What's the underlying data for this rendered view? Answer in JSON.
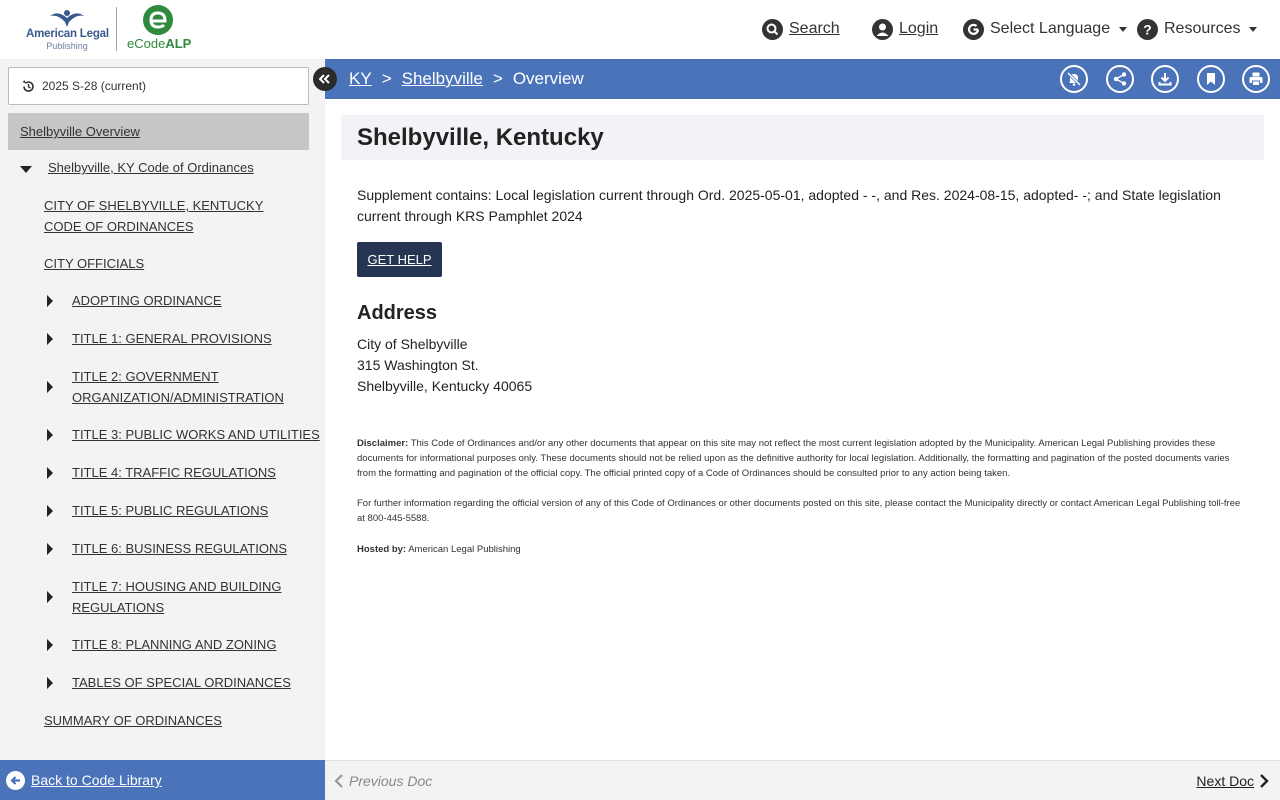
{
  "header": {
    "logo_alp_line1": "American Legal",
    "logo_alp_line2": "Publishing",
    "logo_ecode_prefix": "eCode",
    "logo_ecode_suffix": "ALP",
    "nav": {
      "search": "Search",
      "login": "Login",
      "language": "Select Language",
      "resources": "Resources"
    }
  },
  "sidebar": {
    "version": "2025 S-28 (current)",
    "active_item": "Shelbyville Overview",
    "code_root": "Shelbyville, KY Code of Ordinances",
    "items": [
      "CITY OF SHELBYVILLE, KENTUCKY CODE OF ORDINANCES",
      "CITY OFFICIALS",
      "ADOPTING ORDINANCE",
      "TITLE 1: GENERAL PROVISIONS",
      "TITLE 2: GOVERNMENT ORGANIZATION/ADMINISTRATION",
      "TITLE 3: PUBLIC WORKS AND UTILITIES",
      "TITLE 4: TRAFFIC REGULATIONS",
      "TITLE 5: PUBLIC REGULATIONS",
      "TITLE 6: BUSINESS REGULATIONS",
      "TITLE 7: HOUSING AND BUILDING REGULATIONS",
      "TITLE 8: PLANNING AND ZONING",
      "TABLES OF SPECIAL ORDINANCES",
      "SUMMARY OF ORDINANCES"
    ]
  },
  "breadcrumb": {
    "state": "KY",
    "city": "Shelbyville",
    "current": "Overview",
    "separator": ">"
  },
  "content": {
    "title": "Shelbyville, Kentucky",
    "supplement": "Supplement contains: Local legislation current through Ord. 2025-05-01, adopted - -, and Res. 2024-08-15, adopted- -; and State legislation current through KRS Pamphlet 2024",
    "get_help": "GET HELP",
    "address_heading": "Address",
    "address_lines": [
      "City of Shelbyville",
      "315 Washington St.",
      "Shelbyville, Kentucky 40065"
    ],
    "disclaimer_label": "Disclaimer:",
    "disclaimer_text": "This Code of Ordinances and/or any other documents that appear on this site may not reflect the most current legislation adopted by the Municipality. American Legal Publishing provides these documents for informational purposes only. These documents should not be relied upon as the definitive authority for local legislation. Additionally, the formatting and pagination of the posted documents varies from the formatting and pagination of the official copy. The official printed copy of a Code of Ordinances should be consulted prior to any action being taken.",
    "further_info": "For further information regarding the official version of any of this Code of Ordinances or other documents posted on this site, please contact the Municipality directly or contact American Legal Publishing toll-free at 800-445-5588.",
    "hosted_label": "Hosted by:",
    "hosted_value": "American Legal Publishing"
  },
  "footer": {
    "back": "Back to Code Library",
    "prev": "Previous Doc",
    "next": "Next Doc"
  },
  "colors": {
    "brand_blue": "#4a73b9",
    "button_dark": "#253552",
    "sidebar_bg": "#f3f3f3",
    "active_item_bg": "#c6c6c6"
  }
}
